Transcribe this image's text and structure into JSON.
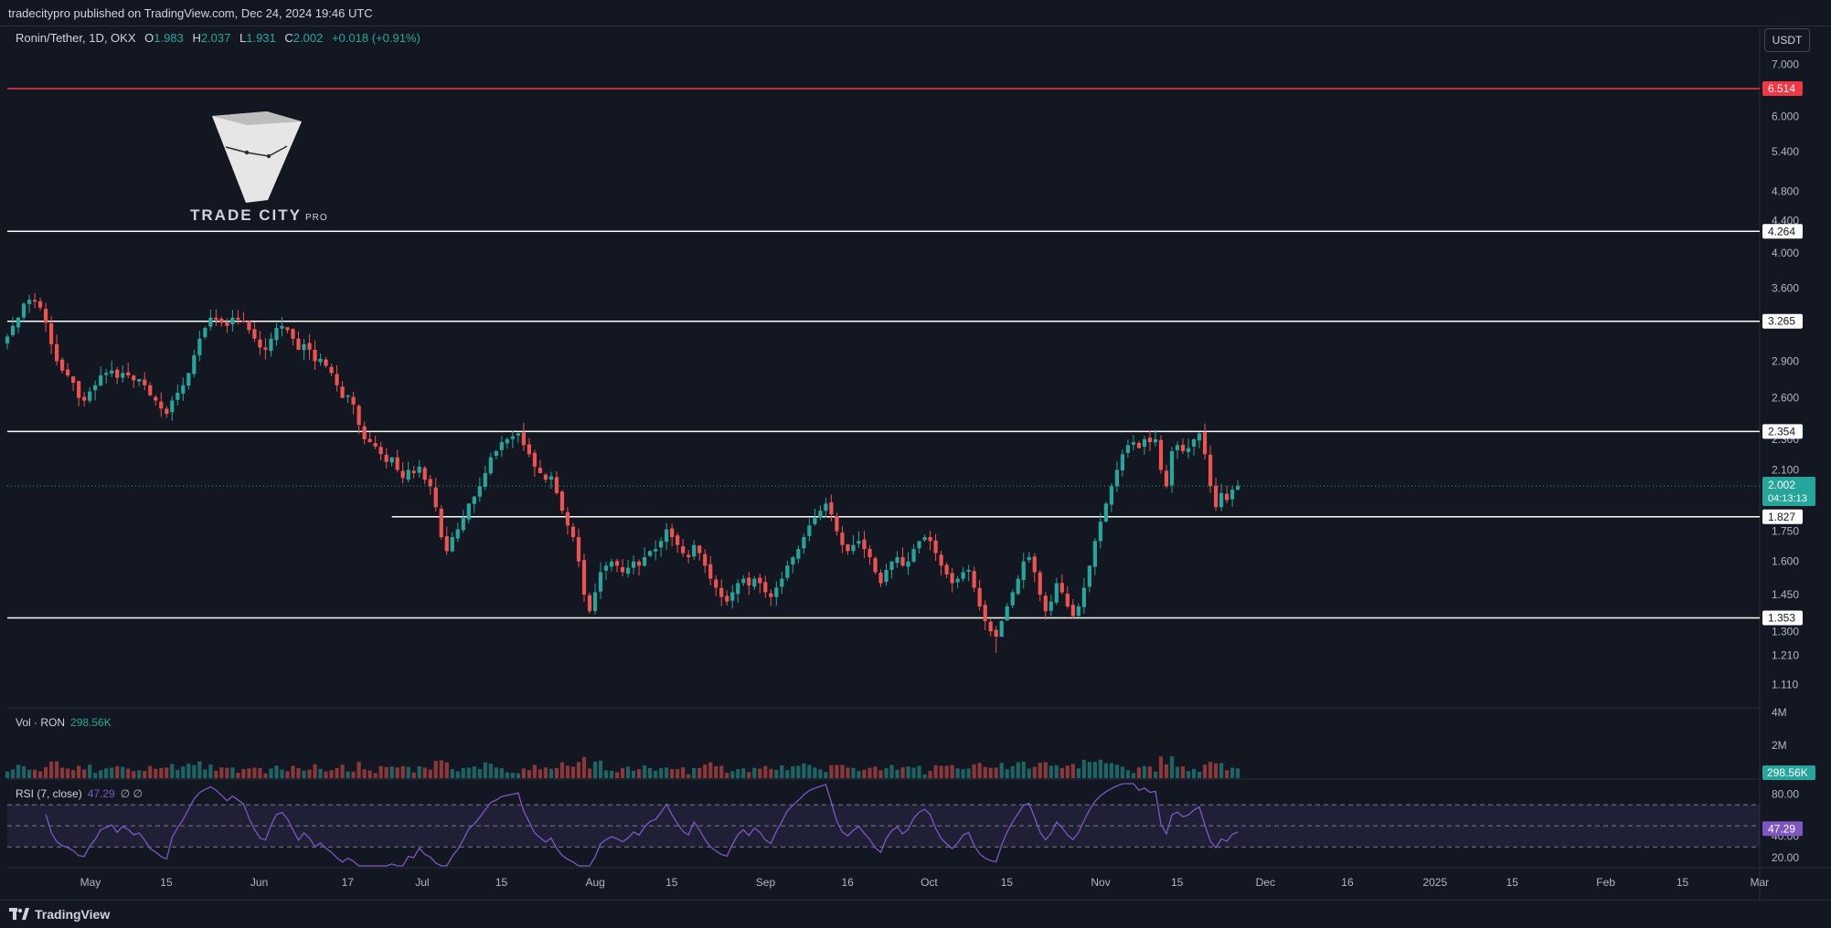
{
  "header": {
    "publish_line": "tradecitypro published on TradingView.com, Dec 24, 2024 19:46 UTC"
  },
  "legend": {
    "symbol": "Ronin/Tether, 1D, OKX",
    "o_label": "O",
    "o_value": "1.983",
    "h_label": "H",
    "h_value": "2.037",
    "l_label": "L",
    "l_value": "1.931",
    "c_label": "C",
    "c_value": "2.002",
    "change": "+0.018 (+0.91%)"
  },
  "currency_button": "USDT",
  "logo": {
    "text": "TRADE CITY",
    "suffix": "PRO"
  },
  "footer": {
    "brand": "TradingView"
  },
  "colors": {
    "background": "#131722",
    "up": "#26a69a",
    "down": "#ef5350",
    "level_line": "#ffffff",
    "resistance_line": "#f23645",
    "rsi": "#7e57c2",
    "grid": "#2a2e39",
    "axis_text": "#b2b5be"
  },
  "chart_data": {
    "type": "candlestick",
    "price_axis": {
      "scale": "log",
      "ticks": [
        "7.000",
        "6.000",
        "5.400",
        "4.800",
        "4.400",
        "4.000",
        "3.600",
        "2.900",
        "2.600",
        "2.300",
        "2.100",
        "1.750",
        "1.600",
        "1.450",
        "1.300",
        "1.210",
        "1.110"
      ],
      "ylim": [
        1.05,
        7.4
      ]
    },
    "price_markers": [
      {
        "value": 6.514,
        "label": "6.514",
        "color": "#f23645"
      },
      {
        "value": 4.264,
        "label": "4.264",
        "color": "#ffffff"
      },
      {
        "value": 3.265,
        "label": "3.265",
        "color": "#ffffff"
      },
      {
        "value": 2.354,
        "label": "2.354",
        "color": "#ffffff"
      },
      {
        "value": 1.827,
        "label": "1.827",
        "color": "#ffffff"
      },
      {
        "value": 1.353,
        "label": "1.353",
        "color": "#ffffff"
      }
    ],
    "current_price": {
      "value": 2.002,
      "label": "2.002",
      "countdown": "04:13:13"
    },
    "horizontal_levels": [
      {
        "value": 6.514,
        "color": "#f23645",
        "start_date": "2024-04-16"
      },
      {
        "value": 4.264,
        "color": "#ffffff",
        "start_date": "2024-04-16"
      },
      {
        "value": 3.265,
        "color": "#ffffff",
        "start_date": "2024-04-16"
      },
      {
        "value": 2.354,
        "color": "#ffffff",
        "start_date": "2024-04-16"
      },
      {
        "value": 1.827,
        "color": "#ffffff",
        "start_date": "2024-06-25"
      },
      {
        "value": 1.353,
        "color": "#ffffff",
        "start_date": "2024-04-16"
      }
    ],
    "time_axis": {
      "ticks": [
        {
          "date": "2024-05-01",
          "label": "May"
        },
        {
          "date": "2024-05-15",
          "label": "15"
        },
        {
          "date": "2024-06-01",
          "label": "Jun"
        },
        {
          "date": "2024-06-17",
          "label": "17"
        },
        {
          "date": "2024-07-01",
          "label": "Jul"
        },
        {
          "date": "2024-07-15",
          "label": "15"
        },
        {
          "date": "2024-08-01",
          "label": "Aug"
        },
        {
          "date": "2024-08-15",
          "label": "15"
        },
        {
          "date": "2024-09-01",
          "label": "Sep"
        },
        {
          "date": "2024-09-16",
          "label": "16"
        },
        {
          "date": "2024-10-01",
          "label": "Oct"
        },
        {
          "date": "2024-10-15",
          "label": "15"
        },
        {
          "date": "2024-11-01",
          "label": "Nov"
        },
        {
          "date": "2024-11-15",
          "label": "15"
        },
        {
          "date": "2024-12-01",
          "label": "Dec"
        },
        {
          "date": "2024-12-16",
          "label": "16"
        },
        {
          "date": "2025-01-01",
          "label": "2025"
        },
        {
          "date": "2025-01-15",
          "label": "15"
        },
        {
          "date": "2025-02-01",
          "label": "Feb"
        },
        {
          "date": "2025-02-15",
          "label": "15"
        },
        {
          "date": "2025-03-01",
          "label": "Mar"
        }
      ],
      "xlim": [
        "2024-04-16",
        "2025-03-01"
      ]
    },
    "close_series": {
      "start_date": "2024-04-16",
      "interval": "1D",
      "closes": [
        3.12,
        3.22,
        3.3,
        3.44,
        3.48,
        3.46,
        3.4,
        3.25,
        3.05,
        2.9,
        2.82,
        2.78,
        2.72,
        2.6,
        2.58,
        2.65,
        2.7,
        2.78,
        2.8,
        2.82,
        2.76,
        2.8,
        2.78,
        2.74,
        2.75,
        2.7,
        2.62,
        2.58,
        2.52,
        2.48,
        2.58,
        2.64,
        2.7,
        2.8,
        2.95,
        3.1,
        3.2,
        3.3,
        3.28,
        3.25,
        3.22,
        3.3,
        3.28,
        3.26,
        3.18,
        3.1,
        3.02,
        3.0,
        3.1,
        3.2,
        3.22,
        3.18,
        3.1,
        3.0,
        3.05,
        3.0,
        2.9,
        2.92,
        2.86,
        2.8,
        2.7,
        2.6,
        2.62,
        2.55,
        2.4,
        2.3,
        2.28,
        2.25,
        2.2,
        2.15,
        2.18,
        2.1,
        2.05,
        2.1,
        2.08,
        2.12,
        2.04,
        2.0,
        1.88,
        1.72,
        1.65,
        1.72,
        1.76,
        1.82,
        1.9,
        1.94,
        2.0,
        2.08,
        2.18,
        2.22,
        2.28,
        2.3,
        2.32,
        2.34,
        2.26,
        2.2,
        2.12,
        2.08,
        2.04,
        2.06,
        1.96,
        1.86,
        1.78,
        1.72,
        1.6,
        1.45,
        1.38,
        1.46,
        1.55,
        1.58,
        1.6,
        1.58,
        1.55,
        1.57,
        1.6,
        1.58,
        1.62,
        1.65,
        1.66,
        1.7,
        1.76,
        1.72,
        1.68,
        1.64,
        1.62,
        1.68,
        1.64,
        1.58,
        1.52,
        1.48,
        1.44,
        1.42,
        1.46,
        1.5,
        1.52,
        1.49,
        1.52,
        1.5,
        1.46,
        1.44,
        1.48,
        1.52,
        1.58,
        1.62,
        1.66,
        1.72,
        1.78,
        1.82,
        1.86,
        1.9,
        1.84,
        1.75,
        1.68,
        1.65,
        1.68,
        1.7,
        1.66,
        1.62,
        1.55,
        1.5,
        1.56,
        1.6,
        1.62,
        1.58,
        1.6,
        1.66,
        1.7,
        1.72,
        1.7,
        1.64,
        1.58,
        1.54,
        1.5,
        1.52,
        1.55,
        1.56,
        1.48,
        1.4,
        1.34,
        1.3,
        1.28,
        1.34,
        1.4,
        1.46,
        1.52,
        1.6,
        1.62,
        1.55,
        1.45,
        1.38,
        1.42,
        1.5,
        1.46,
        1.4,
        1.36,
        1.4,
        1.48,
        1.58,
        1.7,
        1.8,
        1.9,
        2.0,
        2.1,
        2.2,
        2.26,
        2.28,
        2.24,
        2.3,
        2.28,
        2.3,
        2.1,
        2.0,
        2.22,
        2.26,
        2.22,
        2.24,
        2.3,
        2.34,
        2.2,
        2.0,
        1.88,
        1.96,
        1.92,
        1.98,
        2.002
      ],
      "visible_high": 3.55,
      "visible_low": 1.22
    },
    "volume": {
      "label": "Vol · RON",
      "last_value": "298.56K",
      "axis_ticks": [
        "4M",
        "2M"
      ],
      "ylim": [
        0,
        4000000
      ]
    },
    "rsi": {
      "label": "RSI (7, close)",
      "last_value": "47.29",
      "extra": "∅ ∅",
      "axis_ticks": [
        "80.00",
        "40.00",
        "20.00"
      ],
      "band": [
        30,
        70
      ],
      "ylim": [
        12,
        90
      ]
    }
  }
}
